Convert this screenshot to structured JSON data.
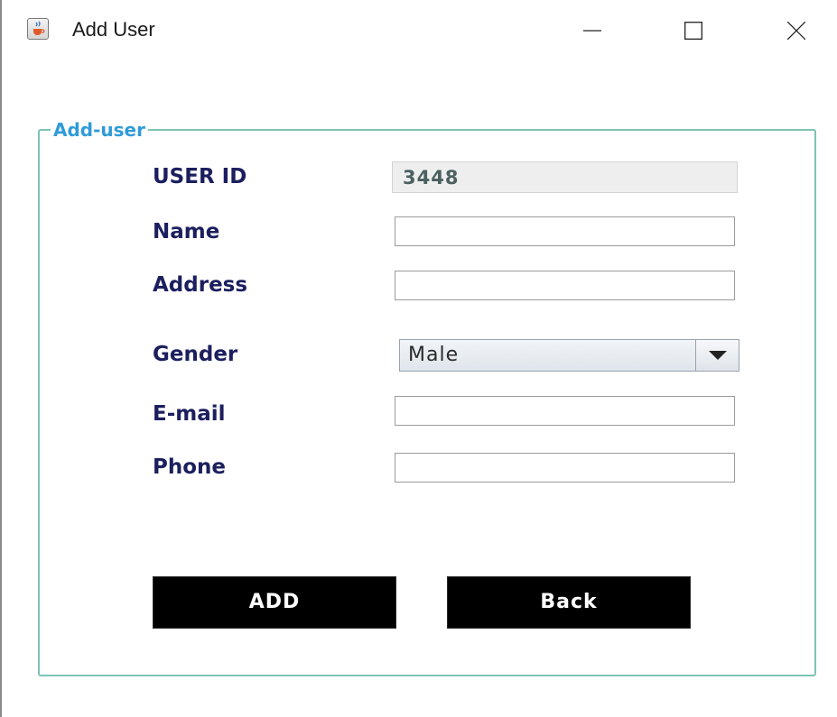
{
  "window": {
    "title": "Add User",
    "icon": "java-coffee-icon",
    "controls": {
      "minimize": "minimize-icon",
      "maximize": "maximize-icon",
      "close": "close-icon"
    }
  },
  "form": {
    "group_title": "Add-user",
    "user_id": {
      "label": "USER ID",
      "value": "3448"
    },
    "name": {
      "label": "Name",
      "value": "",
      "placeholder": ""
    },
    "address": {
      "label": "Address",
      "value": "",
      "placeholder": ""
    },
    "gender": {
      "label": "Gender",
      "selected": "Male"
    },
    "email": {
      "label": "E-mail",
      "value": "",
      "placeholder": ""
    },
    "phone": {
      "label": "Phone",
      "value": "",
      "placeholder": ""
    }
  },
  "buttons": {
    "add_label": "ADD",
    "back_label": "Back"
  },
  "colors": {
    "group_border": "#7ec3b4",
    "group_title": "#2f9bd8",
    "label_text": "#1c1f5e",
    "button_bg": "#000000",
    "button_text": "#ffffff"
  }
}
